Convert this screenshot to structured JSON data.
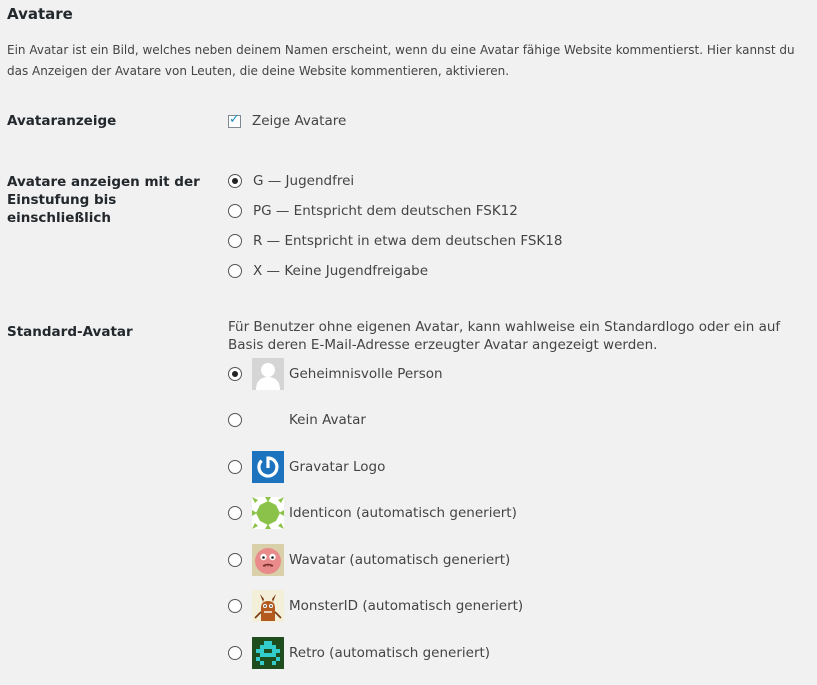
{
  "section": {
    "title": "Avatare",
    "intro": "Ein Avatar ist ein Bild, welches neben deinem Namen erscheint, wenn du eine Avatar fähige Website kommentierst. Hier kannst du das Anzeigen der Avatare von Leuten, die deine Website kommentieren, aktivieren."
  },
  "avatar_display": {
    "label": "Avataranzeige",
    "checkbox_label": "Zeige Avatare",
    "checked": true
  },
  "rating": {
    "label": "Avatare anzeigen mit der Einstufung bis einschließlich",
    "options": [
      {
        "label": "G — Jugendfrei",
        "checked": true
      },
      {
        "label": "PG — Entspricht dem deutschen FSK12",
        "checked": false
      },
      {
        "label": "R — Entspricht in etwa dem deutschen FSK18",
        "checked": false
      },
      {
        "label": "X — Keine Jugendfreigabe",
        "checked": false
      }
    ]
  },
  "default_avatar": {
    "label": "Standard-Avatar",
    "description": "Für Benutzer ohne eigenen Avatar, kann wahlweise ein Standardlogo oder ein auf Basis deren E-Mail-Adresse erzeugter Avatar angezeigt werden.",
    "options": [
      {
        "label": "Geheimnisvolle Person",
        "icon": "mystery-person-icon",
        "checked": true
      },
      {
        "label": "Kein Avatar",
        "icon": "blank-icon",
        "checked": false
      },
      {
        "label": "Gravatar Logo",
        "icon": "gravatar-logo-icon",
        "checked": false
      },
      {
        "label": "Identicon (automatisch generiert)",
        "icon": "identicon-icon",
        "checked": false
      },
      {
        "label": "Wavatar (automatisch generiert)",
        "icon": "wavatar-icon",
        "checked": false
      },
      {
        "label": "MonsterID (automatisch generiert)",
        "icon": "monsterid-icon",
        "checked": false
      },
      {
        "label": "Retro (automatisch generiert)",
        "icon": "retro-icon",
        "checked": false
      }
    ]
  },
  "colors": {
    "background": "#f1f1f1",
    "text": "#23282d",
    "gravatar_blue": "#1e73be",
    "identicon_green": "#8bc34a"
  }
}
